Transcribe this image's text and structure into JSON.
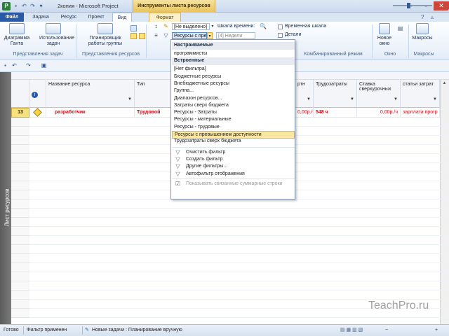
{
  "title_bar": {
    "window_title": "2копия  -  Microsoft Project",
    "context_tab_header": "Инструменты листа ресурсов"
  },
  "tabs": [
    {
      "label": "Файл"
    },
    {
      "label": "Задача"
    },
    {
      "label": "Ресурс"
    },
    {
      "label": "Проект"
    },
    {
      "label": "Вид"
    },
    {
      "label": "Формат"
    }
  ],
  "ribbon": {
    "gantt_chart": "Диаграмма Ганта",
    "task_usage": "Использование задач",
    "team_planner": "Планировщик работы группы",
    "group_task_views": "Представления задач",
    "group_resource_views": "Представления ресурсов",
    "sort_combo": "[Не выделено]",
    "filter_combo": "Ресурсы с прев",
    "group_combo": "[4] Недели",
    "timescale_label": "Шкала времени:",
    "timeline_label": "Временная шкала",
    "details_label": "Детали",
    "group_combined": "Комбинированный режим",
    "new_window": "Новое окно",
    "group_window": "Окно",
    "macros": "Макросы",
    "group_macros": "Макросы"
  },
  "grid": {
    "viewbar_label": "Лист ресурсов",
    "columns": [
      "Название ресурса",
      "Тип",
      "Трудозатраты",
      "Ставка сверхурочных",
      "статьи затрат"
    ],
    "partial_header": "ртн",
    "row": {
      "number": "13",
      "name": "разработчик",
      "type": "Трудовой",
      "rate": "0,00р./ч",
      "work": "548 ч",
      "overtime": "0,00р./ч",
      "cost": "зарплата прогр"
    }
  },
  "filter_dropdown": {
    "items": [
      {
        "label": "Настраиваемые",
        "kind": "head"
      },
      {
        "label": "программисты",
        "kind": "item"
      },
      {
        "label": "Встроенные",
        "kind": "head"
      },
      {
        "label": "[Нет фильтра]",
        "kind": "item"
      },
      {
        "label": "Бюджетные ресурсы",
        "kind": "item"
      },
      {
        "label": "Внебюджетные ресурсы",
        "kind": "item"
      },
      {
        "label": "Группа...",
        "kind": "item"
      },
      {
        "label": "Диапазон ресурсов...",
        "kind": "item"
      },
      {
        "label": "Затраты сверх бюджета",
        "kind": "item"
      },
      {
        "label": "Ресурсы - Затраты",
        "kind": "item"
      },
      {
        "label": "Ресурсы - материальные",
        "kind": "item"
      },
      {
        "label": "Ресурсы - трудовые",
        "kind": "item"
      },
      {
        "label": "Ресурсы с превышением доступности",
        "kind": "selected"
      },
      {
        "label": "Трудозатраты сверх бюджета",
        "kind": "item"
      },
      {
        "label": "Очистить фильтр",
        "kind": "icon"
      },
      {
        "label": "Создать фильтр",
        "kind": "icon"
      },
      {
        "label": "Другие фильтры...",
        "kind": "icon"
      },
      {
        "label": "Автофильтр отображения",
        "kind": "icon"
      },
      {
        "label": "Показывать связанные суммарные строки",
        "kind": "disabled"
      }
    ]
  },
  "status_bar": {
    "ready": "Готово",
    "filter": "Фильтр применен",
    "new_tasks": "Новые задачи : Планирование вручную"
  },
  "watermark": "TeachPro.ru"
}
